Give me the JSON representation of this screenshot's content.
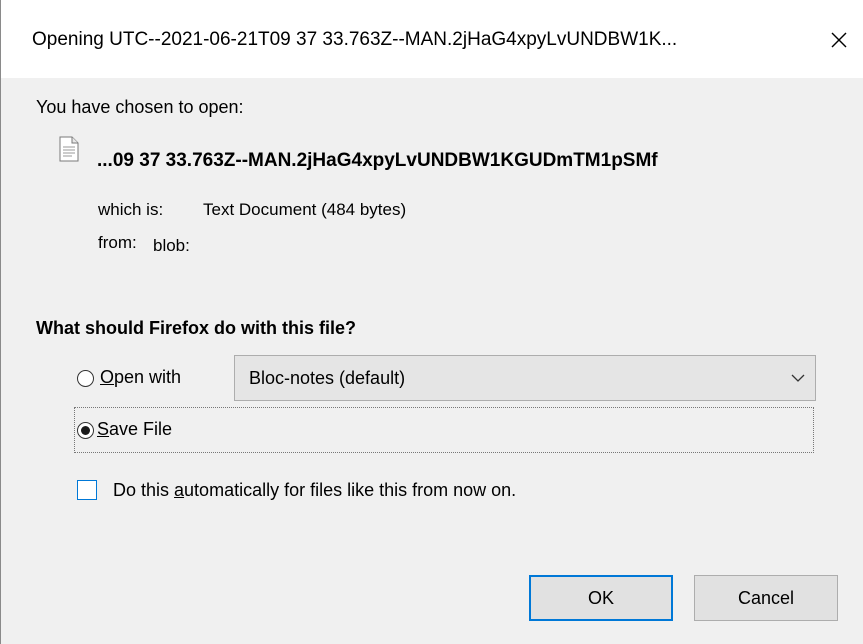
{
  "window": {
    "title": "Opening UTC--2021-06-21T09 37 33.763Z--MAN.2jHaG4xpyLvUNDBW1K..."
  },
  "info": {
    "chosen_label": "You have chosen to open:",
    "filename": "...09 37 33.763Z--MAN.2jHaG4xpyLvUNDBW1KGUDmTM1pSMf",
    "which_is_label": "which is:",
    "which_is_value": "Text Document (484 bytes)",
    "from_label": "from:",
    "from_value": "blob:"
  },
  "action": {
    "question": "What should Firefox do with this file?",
    "open_with": {
      "mnemonic": "O",
      "label_rest": "pen with",
      "selected": false,
      "app": "Bloc-notes (default)"
    },
    "save_file": {
      "mnemonic": "S",
      "label_rest": "ave File",
      "selected": true
    },
    "auto": {
      "label_before": "Do this ",
      "mnemonic": "a",
      "label_after": "utomatically for files like this from now on.",
      "checked": false
    }
  },
  "buttons": {
    "ok": "OK",
    "cancel": "Cancel"
  },
  "colors": {
    "accent": "#0078d7",
    "panel": "#f0f0f0",
    "button": "#e1e1e1"
  }
}
